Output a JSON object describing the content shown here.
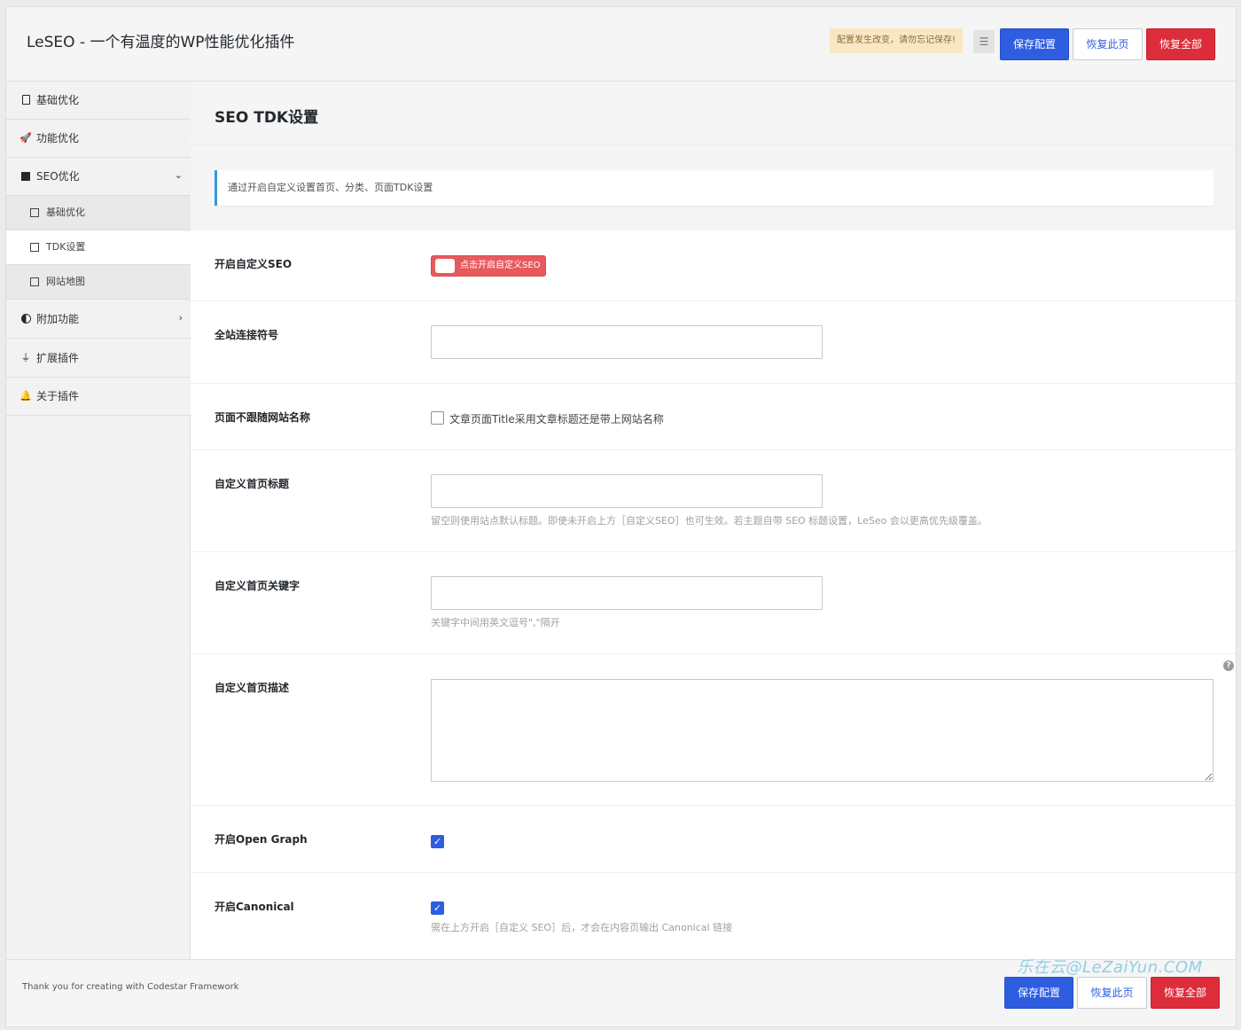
{
  "header": {
    "title": "LeSEO - 一个有温度的WP性能优化插件",
    "notice": "配置发生改变，请勿忘记保存!",
    "expand_icon": "list-indent-icon",
    "save_label": "保存配置",
    "reset_section_label": "恢复此页",
    "reset_all_label": "恢复全部"
  },
  "sidebar": {
    "items": [
      {
        "label": "基础优化",
        "icon": "clipboard-icon"
      },
      {
        "label": "功能优化",
        "icon": "rocket-icon"
      },
      {
        "label": "SEO优化",
        "icon": "square-icon",
        "expanded": true
      },
      {
        "label": "附加功能",
        "icon": "half-circle-icon"
      },
      {
        "label": "扩展插件",
        "icon": "plug-icon"
      },
      {
        "label": "关于插件",
        "icon": "bell-icon"
      }
    ],
    "sub_items": [
      {
        "label": "基础优化"
      },
      {
        "label": "TDK设置",
        "active": true
      },
      {
        "label": "网站地图"
      }
    ]
  },
  "main": {
    "section_title": "SEO TDK设置",
    "info": "通过开启自定义设置首页、分类、页面TDK设置",
    "fields": {
      "custom_seo": {
        "label": "开启自定义SEO",
        "toggle_text": "点击开启自定义SEO",
        "enabled": false
      },
      "separator": {
        "label": "全站连接符号",
        "value": ""
      },
      "no_site_name": {
        "label": "页面不跟随网站名称",
        "checkbox_text": "文章页面Title采用文章标题还是带上网站名称",
        "checked": false
      },
      "home_title": {
        "label": "自定义首页标题",
        "value": "",
        "help": "留空则使用站点默认标题。即使未开启上方［自定义SEO］也可生效。若主题自带 SEO 标题设置，LeSeo 会以更高优先级覆盖。"
      },
      "home_keywords": {
        "label": "自定义首页关键字",
        "value": "",
        "help": "关键字中间用英文逗号\",\"隔开"
      },
      "home_description": {
        "label": "自定义首页描述",
        "value": ""
      },
      "open_graph": {
        "label": "开启Open Graph",
        "checked": true
      },
      "canonical": {
        "label": "开启Canonical",
        "checked": true,
        "help": "需在上方开启［自定义 SEO］后，才会在内容页输出 Canonical 链接"
      }
    }
  },
  "footer": {
    "text": "Thank you for creating with Codestar Framework",
    "watermark": "乐在云@LeZaiYun.COM",
    "save_label": "保存配置",
    "reset_section_label": "恢复此页",
    "reset_all_label": "恢复全部"
  },
  "colors": {
    "primary": "#2f5de0",
    "danger": "#dd2d3b",
    "toggle_off": "#e8595e",
    "info_border": "#3399d6",
    "notice_bg": "#f9e7c3"
  }
}
